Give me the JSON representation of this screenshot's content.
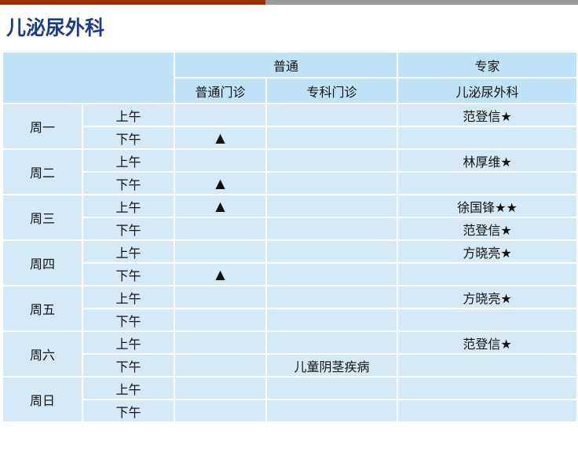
{
  "title": "儿泌尿外科",
  "header": {
    "group_general": "普通",
    "group_expert": "专家",
    "col_general_clinic": "普通门诊",
    "col_specialty_clinic": "专科门诊",
    "col_expert_dept": "儿泌尿外科"
  },
  "days": [
    {
      "name": "周一",
      "am": {
        "label": "上午",
        "general": "",
        "specialty": "",
        "expert": "范登信★"
      },
      "pm": {
        "label": "下午",
        "general": "▲",
        "specialty": "",
        "expert": ""
      }
    },
    {
      "name": "周二",
      "am": {
        "label": "上午",
        "general": "",
        "specialty": "",
        "expert": "林厚维★"
      },
      "pm": {
        "label": "下午",
        "general": "▲",
        "specialty": "",
        "expert": ""
      }
    },
    {
      "name": "周三",
      "am": {
        "label": "上午",
        "general": "▲",
        "specialty": "",
        "expert": "徐国锋★★"
      },
      "pm": {
        "label": "下午",
        "general": "",
        "specialty": "",
        "expert": "范登信★"
      }
    },
    {
      "name": "周四",
      "am": {
        "label": "上午",
        "general": "",
        "specialty": "",
        "expert": "方晓亮★"
      },
      "pm": {
        "label": "下午",
        "general": "▲",
        "specialty": "",
        "expert": ""
      }
    },
    {
      "name": "周五",
      "am": {
        "label": "上午",
        "general": "",
        "specialty": "",
        "expert": "方晓亮★"
      },
      "pm": {
        "label": "下午",
        "general": "",
        "specialty": "",
        "expert": ""
      }
    },
    {
      "name": "周六",
      "am": {
        "label": "上午",
        "general": "",
        "specialty": "",
        "expert": "范登信★"
      },
      "pm": {
        "label": "下午",
        "general": "",
        "specialty": "儿童阴茎疾病",
        "expert": ""
      }
    },
    {
      "name": "周日",
      "am": {
        "label": "上午",
        "general": "",
        "specialty": "",
        "expert": ""
      },
      "pm": {
        "label": "下午",
        "general": "",
        "specialty": "",
        "expert": ""
      }
    }
  ]
}
